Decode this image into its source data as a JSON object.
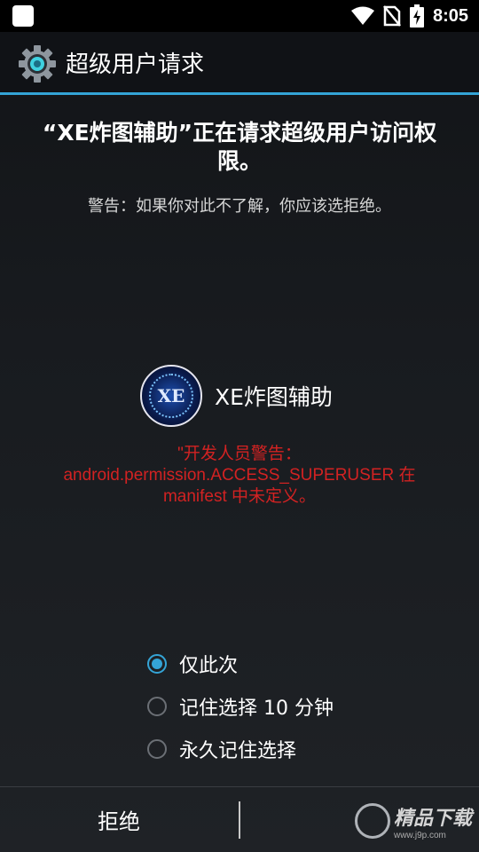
{
  "status_bar": {
    "time": "8:05",
    "icons": [
      "notification-square-icon",
      "wifi-icon",
      "no-sim-icon",
      "battery-charging-icon"
    ]
  },
  "action_bar": {
    "title": "超级用户请求",
    "icon": "gear-icon"
  },
  "dialog": {
    "request_text": "“XE炸图辅助”正在请求超级用户访问权限。",
    "warning_text": "警告：如果你对此不了解，你应该选拒绝。",
    "app": {
      "icon_label": "XE",
      "name": "XE炸图辅助"
    },
    "developer_warning_line1": "\"开发人员警告：",
    "developer_warning_line2": "android.permission.ACCESS_SUPERUSER 在",
    "developer_warning_line3": "manifest 中未定义。"
  },
  "options": [
    {
      "label": "仅此次",
      "checked": true
    },
    {
      "label": "记住选择 10 分钟",
      "checked": false
    },
    {
      "label": "永久记住选择",
      "checked": false
    }
  ],
  "buttons": {
    "deny_label": "拒绝"
  },
  "watermark": {
    "text": "精品下载",
    "url": "www.j9p.com"
  },
  "colors": {
    "accent": "#34a4d6",
    "warning_red": "#d22222"
  }
}
